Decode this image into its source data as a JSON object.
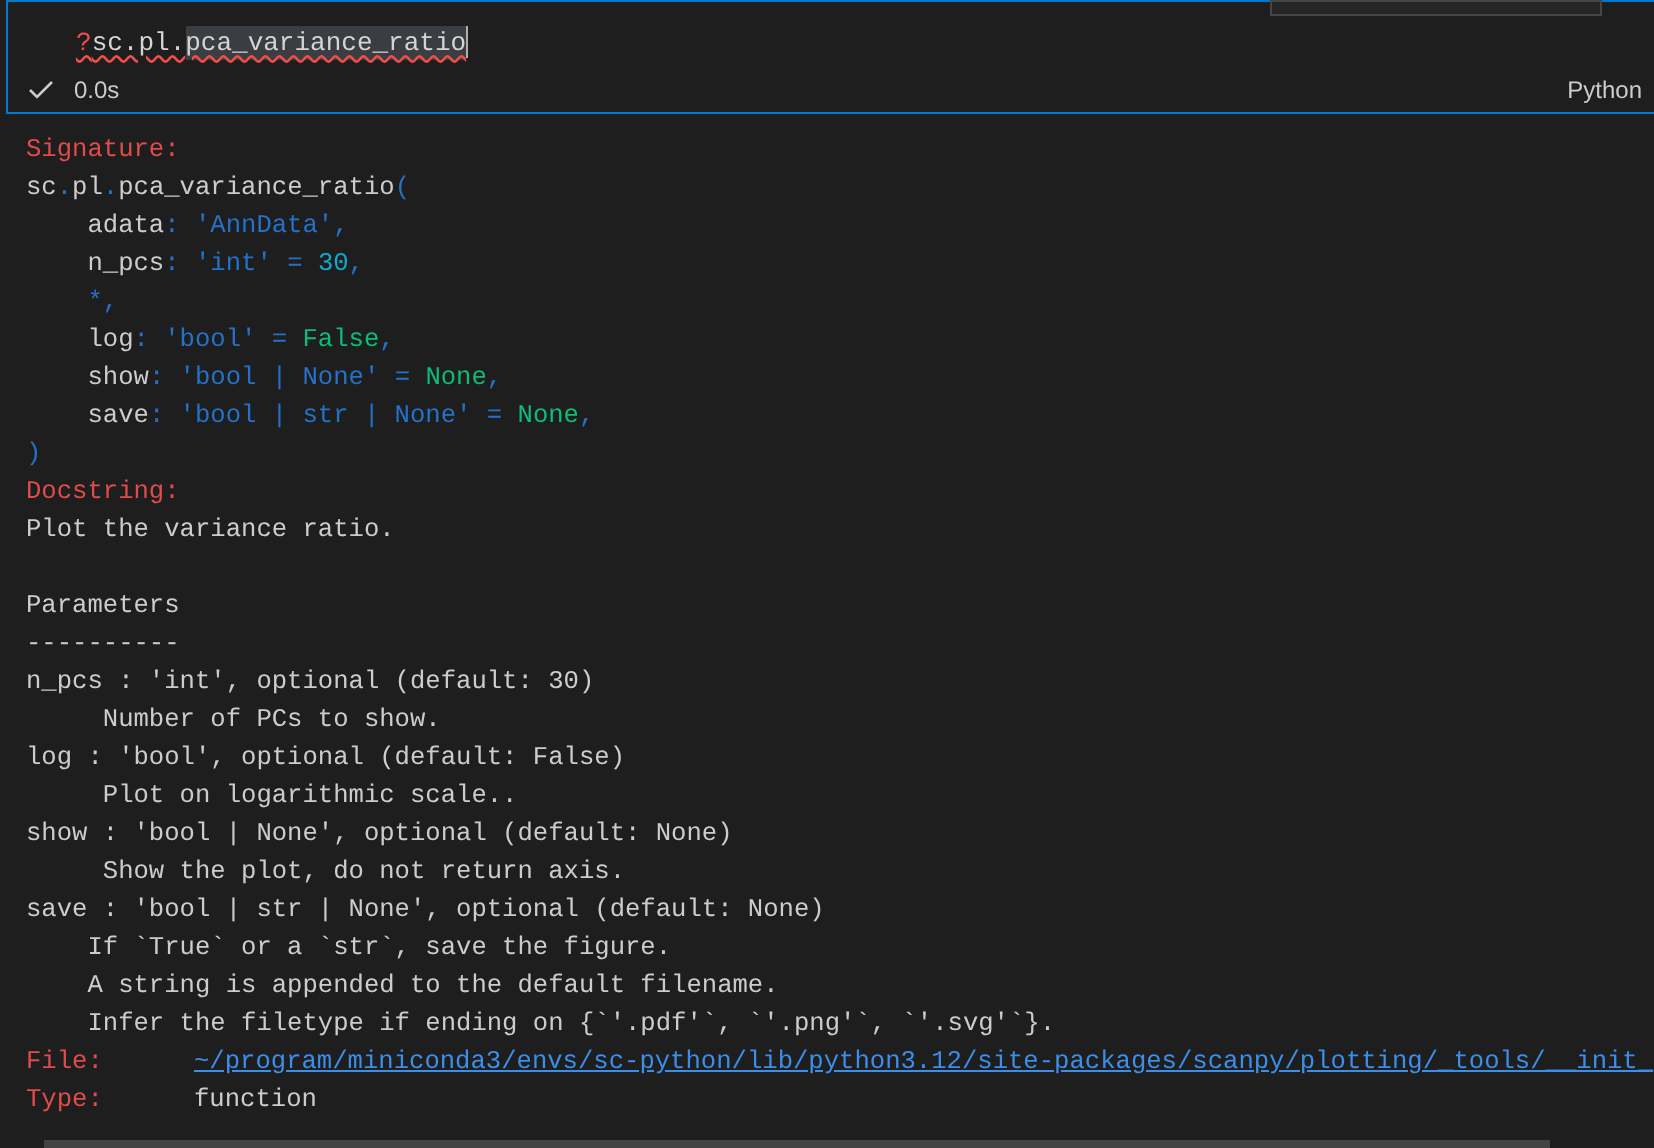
{
  "cell": {
    "input": [
      {
        "text": "?",
        "kind": "error"
      },
      {
        "text": "sc.pl.",
        "kind": "plain"
      },
      {
        "text": "pca_variance_ratio",
        "kind": "selected"
      }
    ],
    "status": {
      "succeeded": true,
      "duration": "0.0s",
      "language": "Python"
    }
  },
  "output": {
    "signature_label": "Signature:",
    "signature": [
      [
        {
          "text": "sc",
          "kind": "name"
        },
        {
          "text": ".",
          "kind": "op"
        },
        {
          "text": "pl",
          "kind": "name"
        },
        {
          "text": ".",
          "kind": "op"
        },
        {
          "text": "pca_variance_ratio",
          "kind": "name"
        },
        {
          "text": "(",
          "kind": "op"
        }
      ],
      [
        {
          "text": "    adata",
          "kind": "name"
        },
        {
          "text": ": ",
          "kind": "op"
        },
        {
          "text": "'AnnData'",
          "kind": "string"
        },
        {
          "text": ",",
          "kind": "op"
        }
      ],
      [
        {
          "text": "    n_pcs",
          "kind": "name"
        },
        {
          "text": ": ",
          "kind": "op"
        },
        {
          "text": "'int'",
          "kind": "string"
        },
        {
          "text": " = ",
          "kind": "op"
        },
        {
          "text": "30",
          "kind": "number"
        },
        {
          "text": ",",
          "kind": "op"
        }
      ],
      [
        {
          "text": "    *,",
          "kind": "op"
        }
      ],
      [
        {
          "text": "    log",
          "kind": "name"
        },
        {
          "text": ": ",
          "kind": "op"
        },
        {
          "text": "'bool'",
          "kind": "string"
        },
        {
          "text": " = ",
          "kind": "op"
        },
        {
          "text": "False",
          "kind": "constant"
        },
        {
          "text": ",",
          "kind": "op"
        }
      ],
      [
        {
          "text": "    show",
          "kind": "name"
        },
        {
          "text": ": ",
          "kind": "op"
        },
        {
          "text": "'bool | None'",
          "kind": "string"
        },
        {
          "text": " = ",
          "kind": "op"
        },
        {
          "text": "None",
          "kind": "constant"
        },
        {
          "text": ",",
          "kind": "op"
        }
      ],
      [
        {
          "text": "    save",
          "kind": "name"
        },
        {
          "text": ": ",
          "kind": "op"
        },
        {
          "text": "'bool | str | None'",
          "kind": "string"
        },
        {
          "text": " = ",
          "kind": "op"
        },
        {
          "text": "None",
          "kind": "constant"
        },
        {
          "text": ",",
          "kind": "op"
        }
      ],
      [
        {
          "text": ")",
          "kind": "op"
        }
      ]
    ],
    "docstring_label": "Docstring:",
    "summary": "Plot the variance ratio.",
    "docstring": [
      "Parameters",
      "----------",
      "n_pcs : 'int', optional (default: 30)",
      "     Number of PCs to show.",
      "log : 'bool', optional (default: False)",
      "     Plot on logarithmic scale..",
      "show : 'bool | None', optional (default: None)",
      "     Show the plot, do not return axis.",
      "save : 'bool | str | None', optional (default: None)",
      "    If `True` or a `str`, save the figure.",
      "    A string is appended to the default filename.",
      "    Infer the filetype if ending on {`'.pdf'`, `'.png'`, `'.svg'`}."
    ],
    "file_label": "File:",
    "file": "~/program/miniconda3/envs/sc-python/lib/python3.12/site-packages/scanpy/plotting/_tools/__init_",
    "type_label": "Type:",
    "type": "function"
  }
}
